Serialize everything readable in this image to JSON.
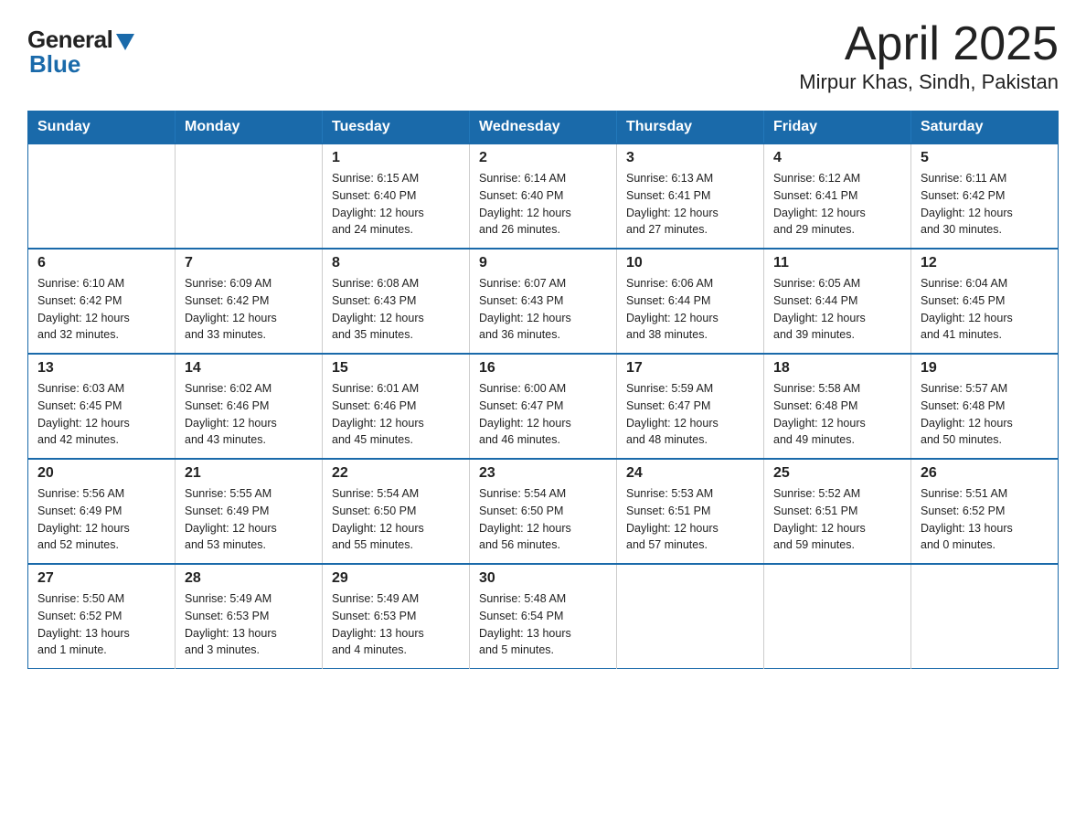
{
  "header": {
    "logo_general": "General",
    "logo_blue": "Blue",
    "title": "April 2025",
    "subtitle": "Mirpur Khas, Sindh, Pakistan"
  },
  "days_of_week": [
    "Sunday",
    "Monday",
    "Tuesday",
    "Wednesday",
    "Thursday",
    "Friday",
    "Saturday"
  ],
  "weeks": [
    [
      {
        "day": "",
        "info": ""
      },
      {
        "day": "",
        "info": ""
      },
      {
        "day": "1",
        "info": "Sunrise: 6:15 AM\nSunset: 6:40 PM\nDaylight: 12 hours\nand 24 minutes."
      },
      {
        "day": "2",
        "info": "Sunrise: 6:14 AM\nSunset: 6:40 PM\nDaylight: 12 hours\nand 26 minutes."
      },
      {
        "day": "3",
        "info": "Sunrise: 6:13 AM\nSunset: 6:41 PM\nDaylight: 12 hours\nand 27 minutes."
      },
      {
        "day": "4",
        "info": "Sunrise: 6:12 AM\nSunset: 6:41 PM\nDaylight: 12 hours\nand 29 minutes."
      },
      {
        "day": "5",
        "info": "Sunrise: 6:11 AM\nSunset: 6:42 PM\nDaylight: 12 hours\nand 30 minutes."
      }
    ],
    [
      {
        "day": "6",
        "info": "Sunrise: 6:10 AM\nSunset: 6:42 PM\nDaylight: 12 hours\nand 32 minutes."
      },
      {
        "day": "7",
        "info": "Sunrise: 6:09 AM\nSunset: 6:42 PM\nDaylight: 12 hours\nand 33 minutes."
      },
      {
        "day": "8",
        "info": "Sunrise: 6:08 AM\nSunset: 6:43 PM\nDaylight: 12 hours\nand 35 minutes."
      },
      {
        "day": "9",
        "info": "Sunrise: 6:07 AM\nSunset: 6:43 PM\nDaylight: 12 hours\nand 36 minutes."
      },
      {
        "day": "10",
        "info": "Sunrise: 6:06 AM\nSunset: 6:44 PM\nDaylight: 12 hours\nand 38 minutes."
      },
      {
        "day": "11",
        "info": "Sunrise: 6:05 AM\nSunset: 6:44 PM\nDaylight: 12 hours\nand 39 minutes."
      },
      {
        "day": "12",
        "info": "Sunrise: 6:04 AM\nSunset: 6:45 PM\nDaylight: 12 hours\nand 41 minutes."
      }
    ],
    [
      {
        "day": "13",
        "info": "Sunrise: 6:03 AM\nSunset: 6:45 PM\nDaylight: 12 hours\nand 42 minutes."
      },
      {
        "day": "14",
        "info": "Sunrise: 6:02 AM\nSunset: 6:46 PM\nDaylight: 12 hours\nand 43 minutes."
      },
      {
        "day": "15",
        "info": "Sunrise: 6:01 AM\nSunset: 6:46 PM\nDaylight: 12 hours\nand 45 minutes."
      },
      {
        "day": "16",
        "info": "Sunrise: 6:00 AM\nSunset: 6:47 PM\nDaylight: 12 hours\nand 46 minutes."
      },
      {
        "day": "17",
        "info": "Sunrise: 5:59 AM\nSunset: 6:47 PM\nDaylight: 12 hours\nand 48 minutes."
      },
      {
        "day": "18",
        "info": "Sunrise: 5:58 AM\nSunset: 6:48 PM\nDaylight: 12 hours\nand 49 minutes."
      },
      {
        "day": "19",
        "info": "Sunrise: 5:57 AM\nSunset: 6:48 PM\nDaylight: 12 hours\nand 50 minutes."
      }
    ],
    [
      {
        "day": "20",
        "info": "Sunrise: 5:56 AM\nSunset: 6:49 PM\nDaylight: 12 hours\nand 52 minutes."
      },
      {
        "day": "21",
        "info": "Sunrise: 5:55 AM\nSunset: 6:49 PM\nDaylight: 12 hours\nand 53 minutes."
      },
      {
        "day": "22",
        "info": "Sunrise: 5:54 AM\nSunset: 6:50 PM\nDaylight: 12 hours\nand 55 minutes."
      },
      {
        "day": "23",
        "info": "Sunrise: 5:54 AM\nSunset: 6:50 PM\nDaylight: 12 hours\nand 56 minutes."
      },
      {
        "day": "24",
        "info": "Sunrise: 5:53 AM\nSunset: 6:51 PM\nDaylight: 12 hours\nand 57 minutes."
      },
      {
        "day": "25",
        "info": "Sunrise: 5:52 AM\nSunset: 6:51 PM\nDaylight: 12 hours\nand 59 minutes."
      },
      {
        "day": "26",
        "info": "Sunrise: 5:51 AM\nSunset: 6:52 PM\nDaylight: 13 hours\nand 0 minutes."
      }
    ],
    [
      {
        "day": "27",
        "info": "Sunrise: 5:50 AM\nSunset: 6:52 PM\nDaylight: 13 hours\nand 1 minute."
      },
      {
        "day": "28",
        "info": "Sunrise: 5:49 AM\nSunset: 6:53 PM\nDaylight: 13 hours\nand 3 minutes."
      },
      {
        "day": "29",
        "info": "Sunrise: 5:49 AM\nSunset: 6:53 PM\nDaylight: 13 hours\nand 4 minutes."
      },
      {
        "day": "30",
        "info": "Sunrise: 5:48 AM\nSunset: 6:54 PM\nDaylight: 13 hours\nand 5 minutes."
      },
      {
        "day": "",
        "info": ""
      },
      {
        "day": "",
        "info": ""
      },
      {
        "day": "",
        "info": ""
      }
    ]
  ]
}
